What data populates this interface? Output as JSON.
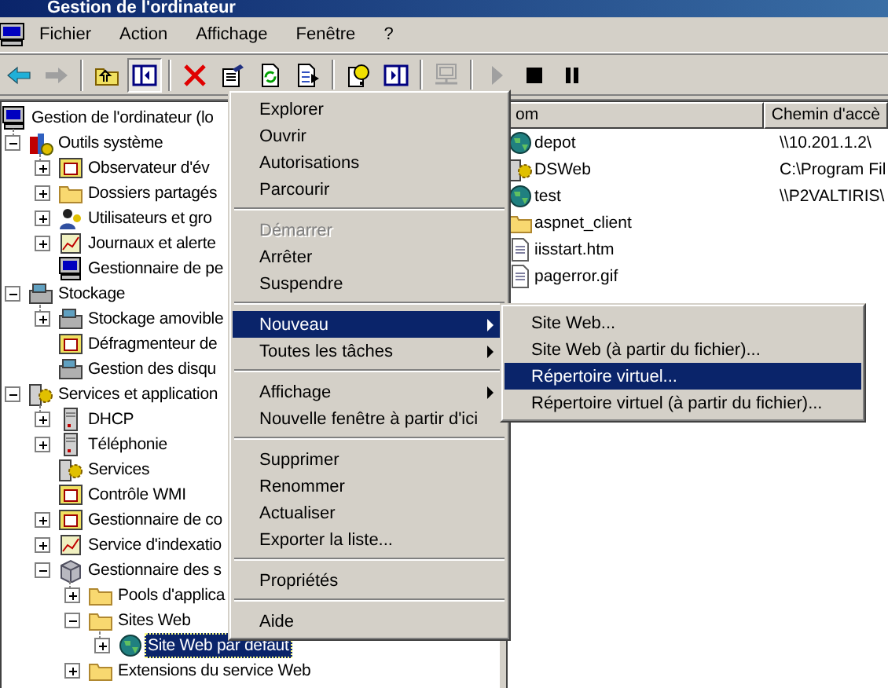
{
  "window": {
    "title": "Gestion de l'ordinateur"
  },
  "menu_bar": [
    "Fichier",
    "Action",
    "Affichage",
    "Fenêtre",
    "?"
  ],
  "toolbar": [
    {
      "kind": "back",
      "disabled": false,
      "pressed": false
    },
    {
      "kind": "forward",
      "disabled": true,
      "pressed": false
    },
    {
      "kind": "separator"
    },
    {
      "kind": "up",
      "disabled": false,
      "pressed": false
    },
    {
      "kind": "tree",
      "disabled": false,
      "pressed": true
    },
    {
      "kind": "separator"
    },
    {
      "kind": "delete",
      "disabled": false,
      "pressed": false
    },
    {
      "kind": "properties",
      "disabled": false,
      "pressed": false
    },
    {
      "kind": "refresh",
      "disabled": false,
      "pressed": false
    },
    {
      "kind": "export",
      "disabled": false,
      "pressed": false
    },
    {
      "kind": "separator"
    },
    {
      "kind": "help",
      "disabled": false,
      "pressed": false
    },
    {
      "kind": "pane",
      "disabled": false,
      "pressed": false
    },
    {
      "kind": "separator"
    },
    {
      "kind": "computer",
      "disabled": true,
      "pressed": false
    },
    {
      "kind": "separator"
    },
    {
      "kind": "play",
      "disabled": true,
      "pressed": false
    },
    {
      "kind": "stop",
      "disabled": false,
      "pressed": false
    },
    {
      "kind": "pause",
      "disabled": false,
      "pressed": false
    }
  ],
  "tree": {
    "items": [
      {
        "label": "Gestion de l'ordinateur (lo",
        "kind": "computer",
        "has_expander": false,
        "expanded": true,
        "selected": false,
        "children": [
          {
            "label": "Outils système",
            "kind": "tools",
            "has_expander": true,
            "expanded": true,
            "selected": false,
            "children": [
              {
                "label": "Observateur d'év",
                "kind": "window",
                "has_expander": true,
                "expanded": false,
                "selected": false
              },
              {
                "label": "Dossiers partagés",
                "kind": "folder",
                "has_expander": true,
                "expanded": false,
                "selected": false
              },
              {
                "label": "Utilisateurs et gro",
                "kind": "users",
                "has_expander": true,
                "expanded": false,
                "selected": false
              },
              {
                "label": "Journaux et alerte",
                "kind": "chart",
                "has_expander": true,
                "expanded": false,
                "selected": false
              },
              {
                "label": "Gestionnaire de pe",
                "kind": "computer",
                "has_expander": false,
                "expanded": false,
                "selected": false
              }
            ]
          },
          {
            "label": "Stockage",
            "kind": "storage",
            "has_expander": true,
            "expanded": true,
            "selected": false,
            "children": [
              {
                "label": "Stockage amovible",
                "kind": "storage",
                "has_expander": true,
                "expanded": false,
                "selected": false
              },
              {
                "label": "Défragmenteur de",
                "kind": "window",
                "has_expander": false,
                "expanded": false,
                "selected": false
              },
              {
                "label": "Gestion des disqu",
                "kind": "storage",
                "has_expander": false,
                "expanded": false,
                "selected": false
              }
            ]
          },
          {
            "label": "Services et application",
            "kind": "gear",
            "has_expander": true,
            "expanded": true,
            "selected": false,
            "children": [
              {
                "label": "DHCP",
                "kind": "server",
                "has_expander": true,
                "expanded": false,
                "selected": false
              },
              {
                "label": "Téléphonie",
                "kind": "server",
                "has_expander": true,
                "expanded": false,
                "selected": false
              },
              {
                "label": "Services",
                "kind": "gear",
                "has_expander": false,
                "expanded": false,
                "selected": false
              },
              {
                "label": "Contrôle WMI",
                "kind": "window",
                "has_expander": false,
                "expanded": false,
                "selected": false
              },
              {
                "label": "Gestionnaire de co",
                "kind": "window",
                "has_expander": true,
                "expanded": false,
                "selected": false
              },
              {
                "label": "Service d'indexatio",
                "kind": "chart",
                "has_expander": true,
                "expanded": false,
                "selected": false
              },
              {
                "label": "Gestionnaire des s",
                "kind": "box",
                "has_expander": true,
                "expanded": true,
                "selected": false,
                "children": [
                  {
                    "label": "Pools d'applica",
                    "kind": "folder",
                    "has_expander": true,
                    "expanded": false,
                    "selected": false
                  },
                  {
                    "label": "Sites Web",
                    "kind": "folder",
                    "has_expander": true,
                    "expanded": true,
                    "selected": false,
                    "children": [
                      {
                        "label": "Site Web par défaut",
                        "kind": "globe",
                        "has_expander": true,
                        "expanded": false,
                        "selected": true
                      }
                    ]
                  },
                  {
                    "label": "Extensions du service Web",
                    "kind": "folder",
                    "has_expander": true,
                    "expanded": false,
                    "selected": false
                  }
                ]
              }
            ]
          }
        ]
      }
    ]
  },
  "list": {
    "columns": [
      "om",
      "Chemin d'accè"
    ],
    "rows": [
      {
        "kind": "globe",
        "cells": [
          "depot",
          "\\\\10.201.1.2\\"
        ]
      },
      {
        "kind": "gear",
        "cells": [
          "DSWeb",
          "C:\\Program Fil"
        ]
      },
      {
        "kind": "globe",
        "cells": [
          "test",
          "\\\\P2VALTIRIS\\"
        ]
      },
      {
        "kind": "folder",
        "cells": [
          "aspnet_client"
        ]
      },
      {
        "kind": "file",
        "cells": [
          "iisstart.htm"
        ]
      },
      {
        "kind": "file",
        "cells": [
          "pagerror.gif"
        ]
      }
    ]
  },
  "context_menu": {
    "items": [
      {
        "kind": "item",
        "label": "Explorer",
        "disabled": false,
        "selected": false,
        "has_submenu": false
      },
      {
        "kind": "item",
        "label": "Ouvrir",
        "disabled": false,
        "selected": false,
        "has_submenu": false
      },
      {
        "kind": "item",
        "label": "Autorisations",
        "disabled": false,
        "selected": false,
        "has_submenu": false
      },
      {
        "kind": "item",
        "label": "Parcourir",
        "disabled": false,
        "selected": false,
        "has_submenu": false
      },
      {
        "kind": "separator"
      },
      {
        "kind": "item",
        "label": "Démarrer",
        "disabled": true,
        "selected": false,
        "has_submenu": false
      },
      {
        "kind": "item",
        "label": "Arrêter",
        "disabled": false,
        "selected": false,
        "has_submenu": false
      },
      {
        "kind": "item",
        "label": "Suspendre",
        "disabled": false,
        "selected": false,
        "has_submenu": false
      },
      {
        "kind": "separator"
      },
      {
        "kind": "item",
        "label": "Nouveau",
        "disabled": false,
        "selected": true,
        "has_submenu": true
      },
      {
        "kind": "item",
        "label": "Toutes les tâches",
        "disabled": false,
        "selected": false,
        "has_submenu": true
      },
      {
        "kind": "separator"
      },
      {
        "kind": "item",
        "label": "Affichage",
        "disabled": false,
        "selected": false,
        "has_submenu": true
      },
      {
        "kind": "item",
        "label": "Nouvelle fenêtre à partir d'ici",
        "disabled": false,
        "selected": false,
        "has_submenu": false
      },
      {
        "kind": "separator"
      },
      {
        "kind": "item",
        "label": "Supprimer",
        "disabled": false,
        "selected": false,
        "has_submenu": false
      },
      {
        "kind": "item",
        "label": "Renommer",
        "disabled": false,
        "selected": false,
        "has_submenu": false
      },
      {
        "kind": "item",
        "label": "Actualiser",
        "disabled": false,
        "selected": false,
        "has_submenu": false
      },
      {
        "kind": "item",
        "label": "Exporter la liste...",
        "disabled": false,
        "selected": false,
        "has_submenu": false
      },
      {
        "kind": "separator"
      },
      {
        "kind": "item",
        "label": "Propriétés",
        "disabled": false,
        "selected": false,
        "has_submenu": false
      },
      {
        "kind": "separator"
      },
      {
        "kind": "item",
        "label": "Aide",
        "disabled": false,
        "selected": false,
        "has_submenu": false
      }
    ]
  },
  "submenu": {
    "items": [
      {
        "kind": "item",
        "label": "Site Web...",
        "disabled": false,
        "selected": false,
        "has_submenu": false
      },
      {
        "kind": "item",
        "label": "Site Web (à partir du fichier)...",
        "disabled": false,
        "selected": false,
        "has_submenu": false
      },
      {
        "kind": "item",
        "label": "Répertoire virtuel...",
        "disabled": false,
        "selected": true,
        "has_submenu": false
      },
      {
        "kind": "item",
        "label": "Répertoire virtuel (à partir du fichier)...",
        "disabled": false,
        "selected": false,
        "has_submenu": false
      }
    ]
  }
}
